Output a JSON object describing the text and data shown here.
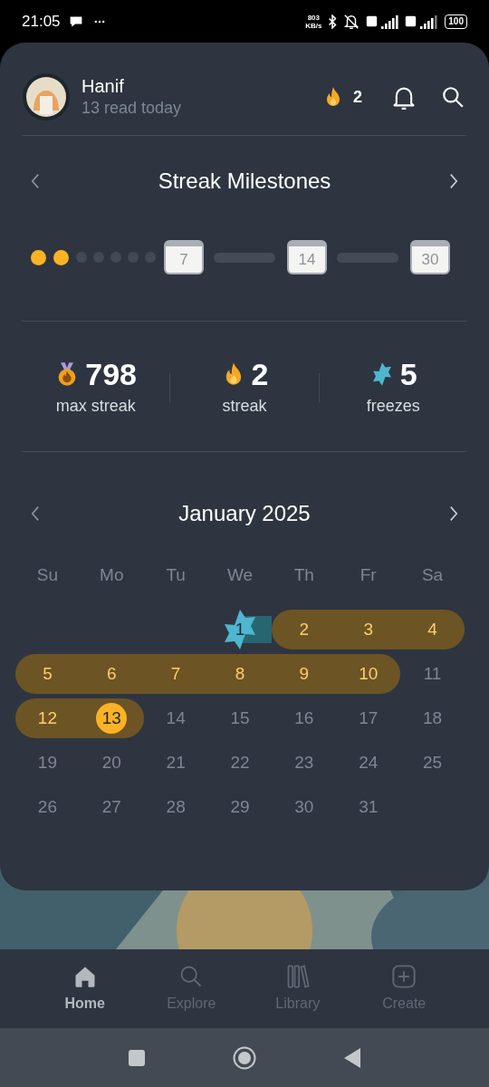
{
  "status_bar": {
    "time": "21:05",
    "speed": "803 KB/s",
    "battery": "100"
  },
  "header": {
    "name": "Hanif",
    "subtitle": "13 read today",
    "streak_count": "2"
  },
  "milestones": {
    "title": "Streak Milestones",
    "dots": [
      {
        "reached": true
      },
      {
        "reached": true
      },
      {
        "reached": false
      },
      {
        "reached": false
      },
      {
        "reached": false
      },
      {
        "reached": false
      },
      {
        "reached": false
      }
    ],
    "targets": [
      {
        "label": "7"
      },
      {
        "label": "14"
      },
      {
        "label": "30"
      }
    ]
  },
  "stats": [
    {
      "kind": "medal",
      "value": "798",
      "label": "max streak"
    },
    {
      "kind": "flame",
      "value": "2",
      "label": "streak"
    },
    {
      "kind": "freeze",
      "value": "5",
      "label": "freezes"
    }
  ],
  "calendar": {
    "month": "January 2025",
    "weekdays": [
      "Su",
      "Mo",
      "Tu",
      "We",
      "Th",
      "Fr",
      "Sa"
    ],
    "weeks": [
      [
        {
          "label": "1",
          "in_streak": false,
          "frozen": true,
          "today": false
        },
        {
          "label": "2",
          "in_streak": true,
          "frozen": false,
          "today": false
        },
        {
          "label": "3",
          "in_streak": true,
          "frozen": false,
          "today": false
        },
        {
          "label": "4",
          "in_streak": true,
          "frozen": false,
          "today": false
        }
      ],
      [
        {
          "label": "5",
          "in_streak": true,
          "frozen": false,
          "today": false
        },
        {
          "label": "6",
          "in_streak": true,
          "frozen": false,
          "today": false
        },
        {
          "label": "7",
          "in_streak": true,
          "frozen": false,
          "today": false
        },
        {
          "label": "8",
          "in_streak": true,
          "frozen": false,
          "today": false
        },
        {
          "label": "9",
          "in_streak": true,
          "frozen": false,
          "today": false
        },
        {
          "label": "10",
          "in_streak": true,
          "frozen": false,
          "today": false
        },
        {
          "label": "11",
          "in_streak": false,
          "frozen": false,
          "today": false
        }
      ],
      [
        {
          "label": "12",
          "in_streak": true,
          "frozen": false,
          "today": false
        },
        {
          "label": "13",
          "in_streak": true,
          "frozen": false,
          "today": true
        },
        {
          "label": "14",
          "in_streak": false,
          "frozen": false,
          "today": false
        },
        {
          "label": "15",
          "in_streak": false,
          "frozen": false,
          "today": false
        },
        {
          "label": "16",
          "in_streak": false,
          "frozen": false,
          "today": false
        },
        {
          "label": "17",
          "in_streak": false,
          "frozen": false,
          "today": false
        },
        {
          "label": "18",
          "in_streak": false,
          "frozen": false,
          "today": false
        }
      ],
      [
        {
          "label": "19",
          "in_streak": false,
          "frozen": false,
          "today": false
        },
        {
          "label": "20",
          "in_streak": false,
          "frozen": false,
          "today": false
        },
        {
          "label": "21",
          "in_streak": false,
          "frozen": false,
          "today": false
        },
        {
          "label": "22",
          "in_streak": false,
          "frozen": false,
          "today": false
        },
        {
          "label": "23",
          "in_streak": false,
          "frozen": false,
          "today": false
        },
        {
          "label": "24",
          "in_streak": false,
          "frozen": false,
          "today": false
        },
        {
          "label": "25",
          "in_streak": false,
          "frozen": false,
          "today": false
        }
      ],
      [
        {
          "label": "26",
          "in_streak": false,
          "frozen": false,
          "today": false
        },
        {
          "label": "27",
          "in_streak": false,
          "frozen": false,
          "today": false
        },
        {
          "label": "28",
          "in_streak": false,
          "frozen": false,
          "today": false
        },
        {
          "label": "29",
          "in_streak": false,
          "frozen": false,
          "today": false
        },
        {
          "label": "30",
          "in_streak": false,
          "frozen": false,
          "today": false
        },
        {
          "label": "31",
          "in_streak": false,
          "frozen": false,
          "today": false
        }
      ]
    ]
  },
  "nav": [
    {
      "kind": "home",
      "label": "Home",
      "selected": true
    },
    {
      "kind": "explore",
      "label": "Explore",
      "selected": false
    },
    {
      "kind": "library",
      "label": "Library",
      "selected": false
    },
    {
      "kind": "create",
      "label": "Create",
      "selected": false
    }
  ]
}
